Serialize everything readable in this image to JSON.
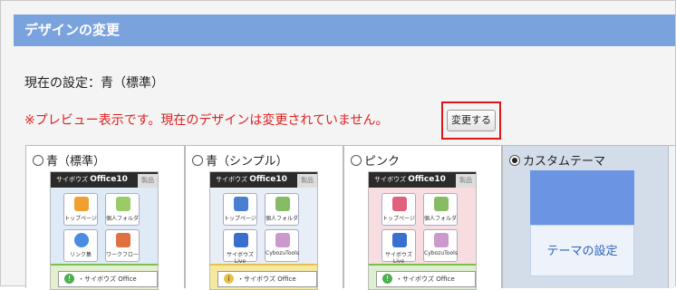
{
  "header": {
    "title": "デザインの変更"
  },
  "current_setting": "現在の設定：青（標準）",
  "notice": "※プレビュー表示です。現在のデザインは変更されていません。",
  "change_button": "変更する",
  "options": [
    {
      "label": "青（標準）",
      "selected": false
    },
    {
      "label": "青（シンプル）",
      "selected": false
    },
    {
      "label": "ピンク",
      "selected": false
    },
    {
      "label": "カスタムテーマ",
      "selected": true
    }
  ],
  "preview": {
    "brand": "サイボウズ",
    "product": "Office10",
    "tab": "製品",
    "icons_standard": [
      "トップページ",
      "個人フォルダ",
      "リンク集",
      "ワークフロー"
    ],
    "icons_alt": [
      "トップページ",
      "個人フォルダ",
      "サイボウズLive",
      "CybozuTools"
    ],
    "footer": "・サイボウズ Office"
  },
  "theme_settings_button": "テーマの設定",
  "colors": {
    "title_bar": "#7aa3de",
    "custom_theme": "#6b95e3",
    "alert": "#e02020"
  }
}
